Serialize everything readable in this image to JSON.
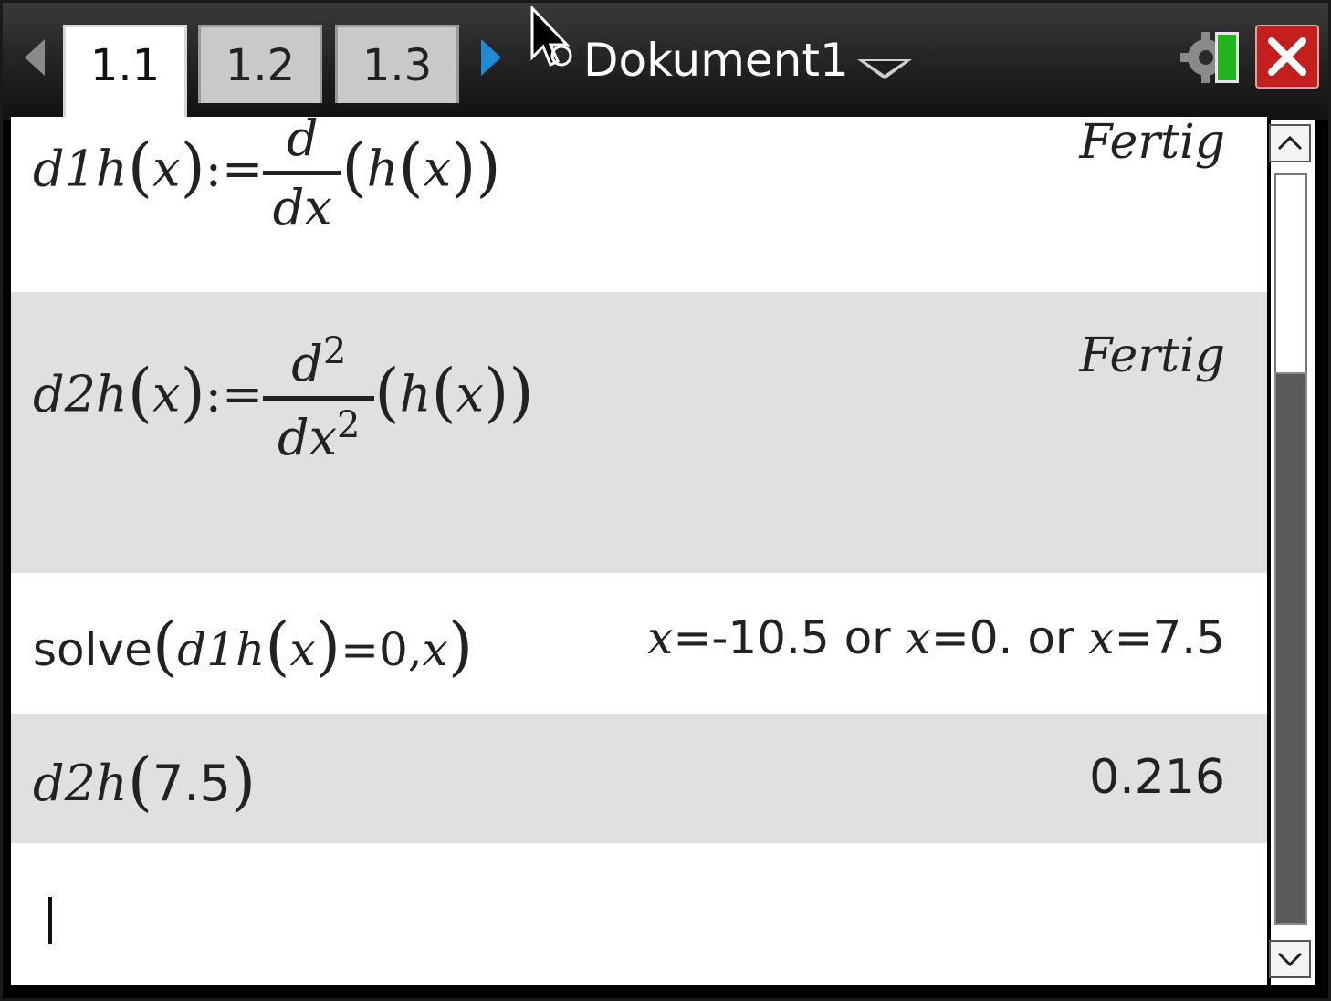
{
  "window": {
    "tabs": [
      {
        "label": "1.1",
        "active": true
      },
      {
        "label": "1.2",
        "active": false
      },
      {
        "label": "1.3",
        "active": false
      }
    ],
    "document_title": "Dokument1",
    "accent_color": "#1f8ad6",
    "close_color": "#c41e1e"
  },
  "entries": [
    {
      "lhs_name": "d1h",
      "lhs_arg": "x",
      "assign": ":=",
      "numerator": "d",
      "denominator": "dx",
      "function_name": "h",
      "function_arg": "x",
      "result": "Fertig"
    },
    {
      "lhs_name": "d2h",
      "lhs_arg": "x",
      "assign": ":=",
      "numerator": "d",
      "numerator_exp": "2",
      "denominator": "dx",
      "denominator_exp": "2",
      "function_name": "h",
      "function_arg": "x",
      "result": "Fertig"
    },
    {
      "command": "solve",
      "inner_name": "d1h",
      "inner_arg": "x",
      "equation_rest": "=0,",
      "solve_var": "x",
      "result_parts": [
        "x",
        "=-10.5 or ",
        "x",
        "=0. or ",
        "x",
        "=7.5"
      ]
    },
    {
      "lhs_name": "d2h",
      "lhs_arg": "7.5",
      "result": "0.216"
    }
  ]
}
